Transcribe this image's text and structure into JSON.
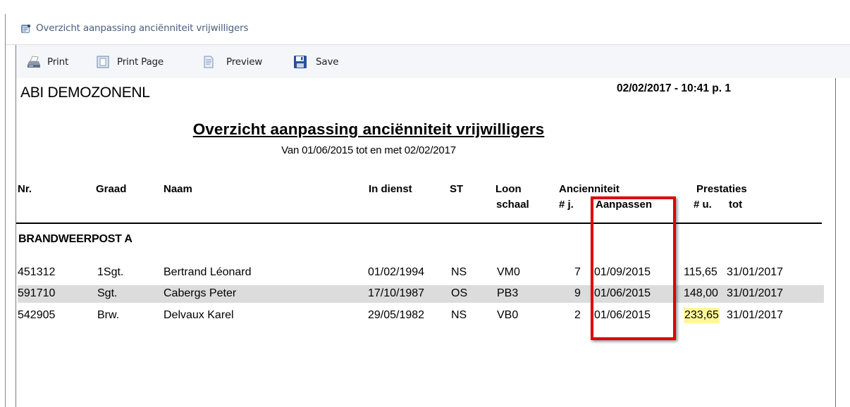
{
  "window": {
    "title": "Overzicht aanpassing anciënniteit vrijwilligers",
    "icon": "report-window-icon"
  },
  "toolbar": {
    "print_label": "Print",
    "print_page_label": "Print Page",
    "preview_label": "Preview",
    "save_label": "Save"
  },
  "report": {
    "organisation": "ABI DEMOZONENL",
    "timestamp": "02/02/2017 - 10:41 p. 1",
    "title": "Overzicht aanpassing anciënniteit vrijwilligers",
    "subtitle": "Van 01/06/2015 tot en met 02/02/2017",
    "headers": {
      "nr": "Nr.",
      "graad": "Graad",
      "naam": "Naam",
      "in_dienst": "In dienst",
      "st": "ST",
      "loon": "Loon",
      "schaal": "schaal",
      "ancienniteit": "Ancienniteit",
      "jaren": "# j.",
      "aanpassen": "Aanpassen",
      "prestaties": "Prestaties",
      "uren": "# u.",
      "tot": "tot"
    },
    "section": "BRANDWEERPOST A",
    "rows": [
      {
        "nr": "451312",
        "graad": "1Sgt.",
        "naam": "Bertrand Léonard",
        "in_dienst": "01/02/1994",
        "st": "NS",
        "schaal": "VM0",
        "jaren": "7",
        "aanpassen": "01/09/2015",
        "uren": "115,65",
        "tot": "31/01/2017"
      },
      {
        "nr": "591710",
        "graad": "Sgt.",
        "naam": "Cabergs Peter",
        "in_dienst": "17/10/1987",
        "st": "OS",
        "schaal": "PB3",
        "jaren": "9",
        "aanpassen": "01/06/2015",
        "uren": "148,00",
        "tot": "31/01/2017"
      },
      {
        "nr": "542905",
        "graad": "Brw.",
        "naam": "Delvaux Karel",
        "in_dienst": "29/05/1982",
        "st": "NS",
        "schaal": "VB0",
        "jaren": "2",
        "aanpassen": "01/06/2015",
        "uren": "233,65",
        "tot": "31/01/2017"
      }
    ]
  },
  "colors": {
    "highlight_box": "#e10000",
    "cell_highlight": "#fff799",
    "shaded_row": "#dcdcdc",
    "title_text": "#4a5f80"
  }
}
